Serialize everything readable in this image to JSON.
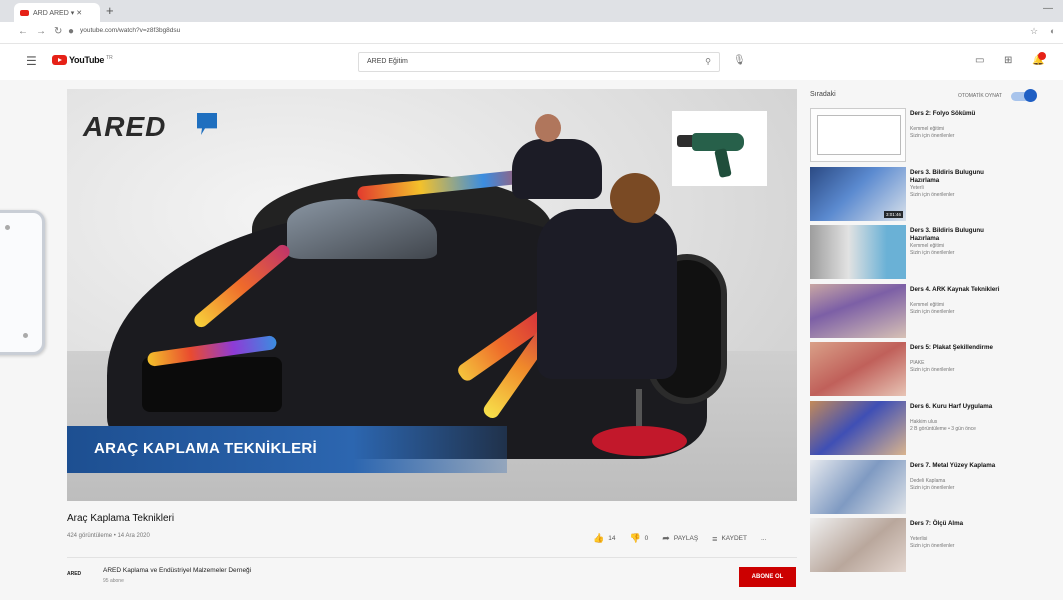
{
  "browser": {
    "tab_title": "ARD ARED ▾ ✕",
    "url": "youtube.com/watch?v=z8f3bg8dsu",
    "new_tab": "+",
    "window_controls": "—"
  },
  "youtube": {
    "logo_text": "YouTube",
    "logo_tr": "TR",
    "search_text": "ARED Eğitim"
  },
  "video": {
    "brand": "ARED",
    "banner_text": "ARAÇ KAPLAMA TEKNİKLERİ",
    "title": "Araç Kaplama Teknikleri",
    "meta": "424 görüntüleme • 14 Ara 2020",
    "actions": {
      "like_count": "14",
      "dislike_count": "0",
      "share_label": "PAYLAŞ",
      "save_label": "KAYDET",
      "more_label": "..."
    }
  },
  "channel": {
    "logo_text": "ARED",
    "name": "ARED Kaplama ve Endüstriyel Malzemeler Derneği",
    "subs": "95 abone",
    "subscribe_label": "ABONE OL"
  },
  "sidebar": {
    "heading": "Sıradaki",
    "autoplay_label": "OTOMATİK OYNAT",
    "items": [
      {
        "title": "Ders 2: Folyo Sökümü",
        "channel": "Kemmel eğitimi",
        "meta": "Sizin için önerilenler",
        "duration": ""
      },
      {
        "title": "Ders 3. Bildiris Bulugunu Hazırlama",
        "channel": "Yeterli",
        "meta": "Sizin için önerilenler",
        "duration": "3:01:46"
      },
      {
        "title": "Ders 3. Bildiris Bulugunu Hazırlama",
        "channel": "Kemmel eğitimi",
        "meta": "Sizin için önerilenler",
        "duration": ""
      },
      {
        "title": "Ders 4. ARK Kaynak Teknikleri",
        "channel": "Kemmel eğitimi",
        "meta": "Sizin için önerilenler",
        "duration": ""
      },
      {
        "title": "Ders 5: Plakat Şekillendirme",
        "channel": "PlAKE",
        "meta": "Sizin için önerilenler",
        "duration": ""
      },
      {
        "title": "Ders 6. Kuru Harf Uygulama",
        "channel": "Hakkim ulus",
        "meta": "2 B görüntüleme • 3 gün önce",
        "duration": ""
      },
      {
        "title": "Ders 7. Metal Yüzey Kaplama",
        "channel": "Dedeli Kaplama",
        "meta": "Sizin için önerilenler",
        "duration": ""
      },
      {
        "title": "Ders 7: Ölçü Alma",
        "channel": "Yeterlisi",
        "meta": "Sizin için önerilenler",
        "duration": ""
      }
    ]
  }
}
